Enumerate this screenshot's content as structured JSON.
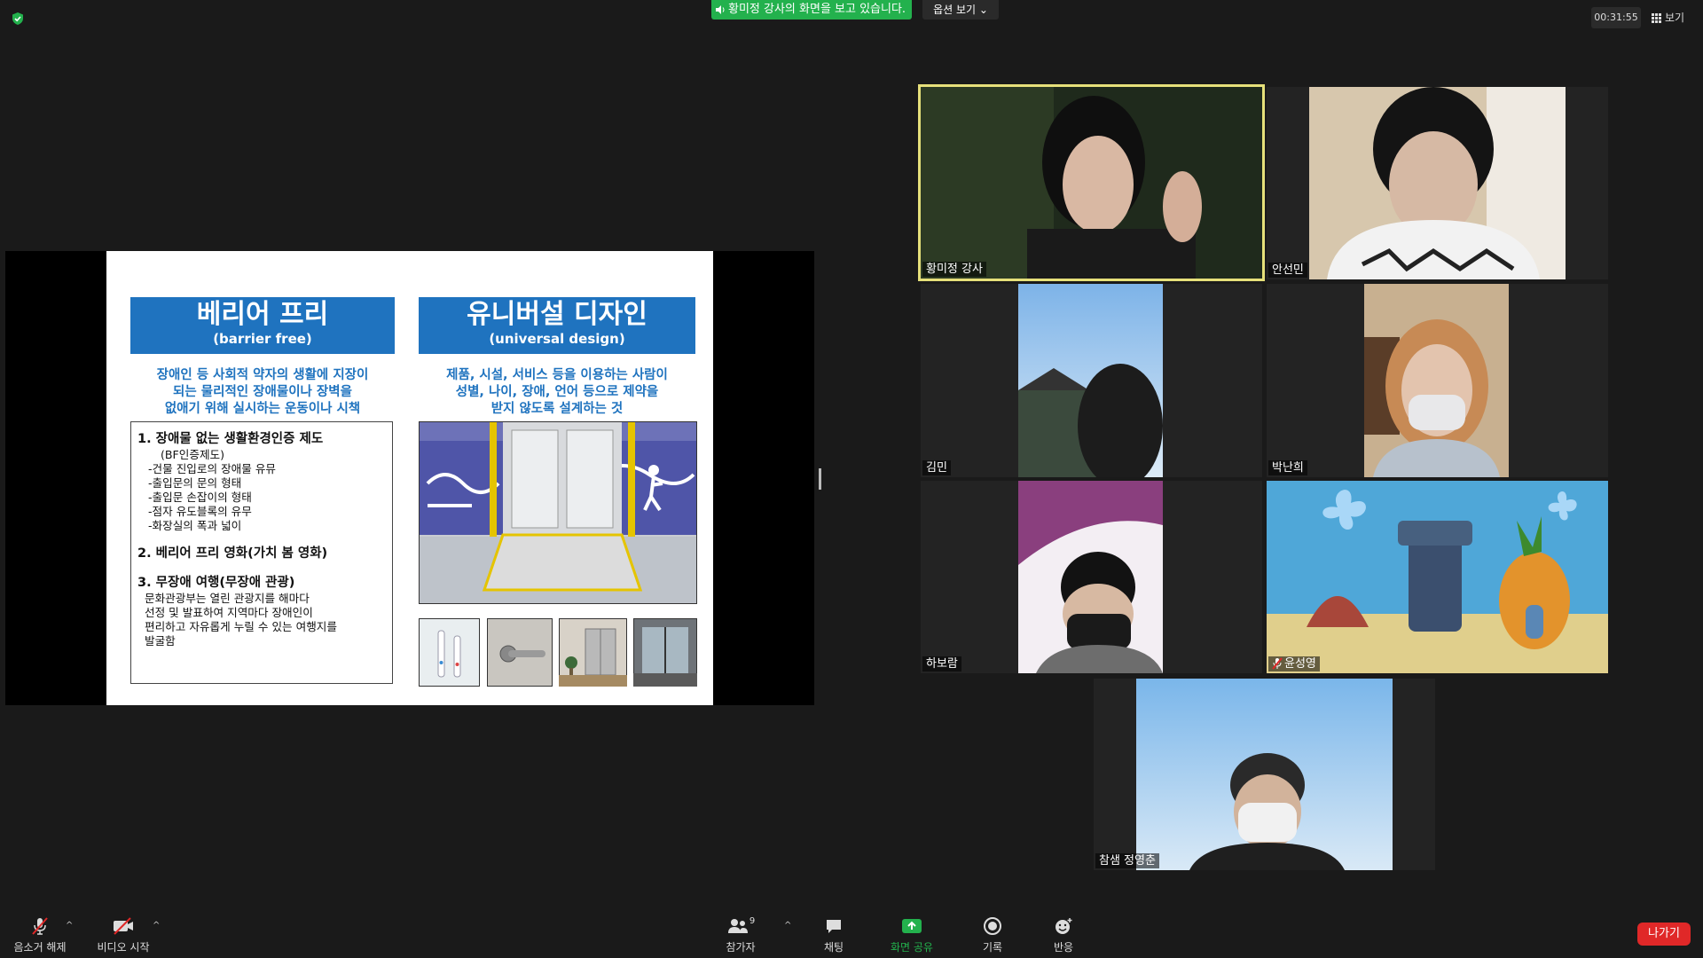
{
  "top": {
    "banner": "황미정 강사의 화면을 보고 있습니다.",
    "view_options": "옵션 보기",
    "timer": "00:31:55",
    "view": "보기"
  },
  "slide": {
    "left": {
      "title": "베리어 프리",
      "subtitle": "(barrier free)",
      "desc1": "장애인 등 사회적 약자의 생활에 지장이",
      "desc2": "되는 물리적인 장애물이나  장벽을",
      "desc3": "없애기 위해 실시하는 운동이나 시책",
      "items": [
        "1. 장애물 없는 생활환경인증 제도",
        "(BF인증제도)",
        "-건물 진입로의 장애물 유뮤",
        "-출입문의 문의 형태",
        "-출입문 손잡이의 형태",
        "-점자 유도블록의 유무",
        "-화장실의 폭과 넓이",
        "2. 베리어 프리 영화(가치 봄 영화)",
        "3. 무장애 여행(무장애 관광)",
        "문화관광부는 열린 관광지를 해마다",
        "선정 및 발표하여 지역마다 장애인이",
        "편리하고 자유롭게 누릴 수 있는 여행지를",
        "발굴함"
      ]
    },
    "right": {
      "title": "유니버설 디자인",
      "subtitle": "(universal design)",
      "desc1": "제품, 시설, 서비스 등을 이용하는 사람이",
      "desc2": "성별, 나이, 장애, 언어 등으로 제약을",
      "desc3": "받지 않도록 설계하는 것"
    }
  },
  "participants": [
    {
      "name": "황미정 강사"
    },
    {
      "name": "안선민"
    },
    {
      "name": "김민"
    },
    {
      "name": "박난희"
    },
    {
      "name": "하보람"
    },
    {
      "name": "윤성영"
    },
    {
      "name": "참샘  정영춘"
    }
  ],
  "toolbar": {
    "mute": "음소거 해제",
    "video": "비디오 시작",
    "participants": "참가자",
    "participants_count": "9",
    "chat": "채팅",
    "share": "화면 공유",
    "record": "기록",
    "reactions": "반응",
    "leave": "나가기"
  },
  "colors": {
    "active_speaker_border": "#e6e07a",
    "share_green": "#23b14d",
    "leave_red": "#e02828",
    "slide_blue": "#1f73bf"
  }
}
